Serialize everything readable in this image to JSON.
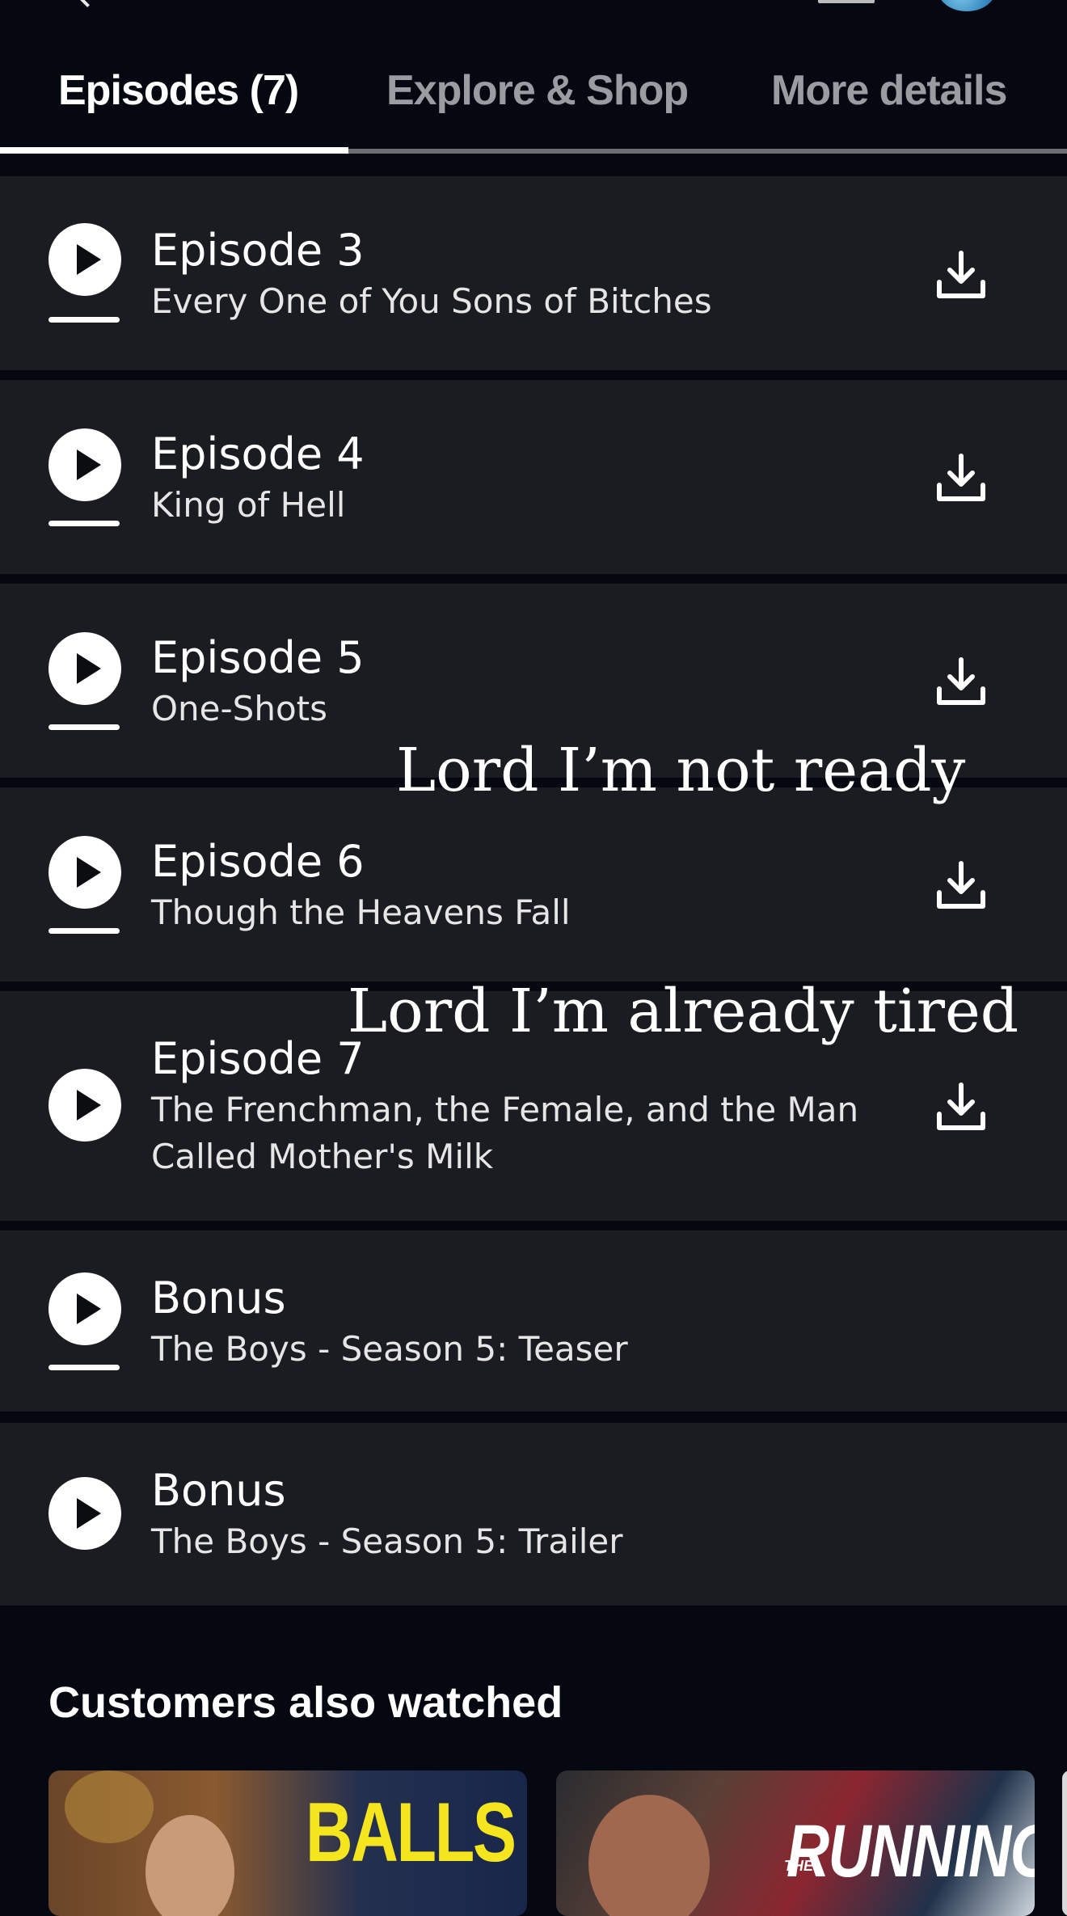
{
  "tabs": [
    {
      "label": "Episodes (7)",
      "active": true
    },
    {
      "label": "Explore & Shop",
      "active": false
    },
    {
      "label": "More details",
      "active": false
    }
  ],
  "episodes": [
    {
      "title": "Episode 3",
      "subtitle": "Every One of You Sons of Bitches",
      "has_progress": true,
      "downloadable": true
    },
    {
      "title": "Episode 4",
      "subtitle": "King of Hell",
      "has_progress": true,
      "downloadable": true
    },
    {
      "title": "Episode 5",
      "subtitle": "One-Shots",
      "has_progress": true,
      "downloadable": true
    },
    {
      "title": "Episode 6",
      "subtitle": "Though the Heavens Fall",
      "has_progress": true,
      "downloadable": true
    },
    {
      "title": "Episode 7",
      "subtitle": "The Frenchman, the Female, and the Man Called Mother's Milk",
      "has_progress": false,
      "downloadable": true
    },
    {
      "title": "Bonus",
      "subtitle": "The Boys - Season 5: Teaser",
      "has_progress": true,
      "downloadable": false
    },
    {
      "title": "Bonus",
      "subtitle": "The Boys - Season 5: Trailer",
      "has_progress": false,
      "downloadable": false
    }
  ],
  "overlay_text": {
    "line1": "Lord I’m not ready",
    "line2": "Lord I’m already tired"
  },
  "customers_also_watched": {
    "heading": "Customers also watched",
    "thumbnails": [
      {
        "text": "BALLS"
      },
      {
        "text": "RUNNING",
        "small_text": "THE"
      }
    ]
  },
  "icons": {
    "play": "play-icon",
    "download": "download-icon"
  },
  "colors": {
    "background": "#050810",
    "row": "#1a1c21",
    "tab_inactive": "#9a9ca1",
    "accent_yellow": "#f5e51f"
  }
}
